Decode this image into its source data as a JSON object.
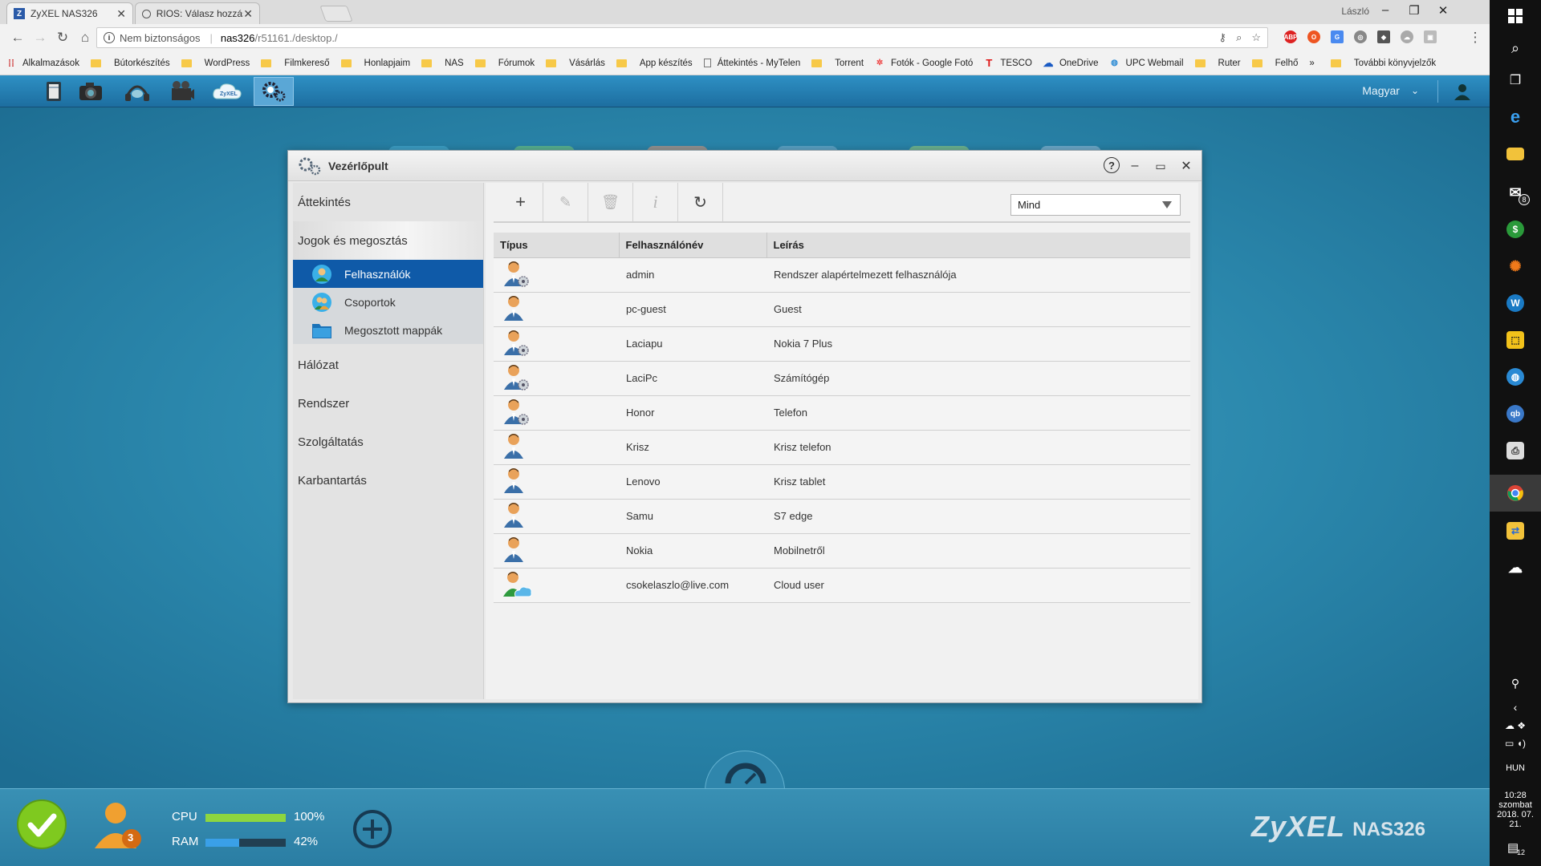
{
  "browser": {
    "tabs": [
      {
        "title": "ZyXEL NAS326",
        "active": true
      },
      {
        "title": "RIOS: Válasz hozzászólás",
        "active": false
      }
    ],
    "profile_name": "László",
    "security_label": "Nem biztonságos",
    "url_host": "nas326",
    "url_path": "/r51161./desktop./",
    "bookmarks": [
      "Alkalmazások",
      "Bútorkészítés",
      "WordPress",
      "Filmkereső",
      "Honlapjaim",
      "NAS",
      "Fórumok",
      "Vásárlás",
      "App készítés",
      "Áttekintés - MyTelen",
      "Torrent",
      "Fotók - Google Fotó",
      "TESCO",
      "OneDrive",
      "UPC Webmail",
      "Ruter",
      "Felhő"
    ],
    "bookmarks_more": "»",
    "other_bookmarks": "További könyvjelzők"
  },
  "nas_topbar": {
    "apps": [
      "file-browser",
      "photo",
      "music",
      "video",
      "zyxel-cloud",
      "control-panel"
    ],
    "active_app": "control-panel",
    "language": "Magyar"
  },
  "control_panel": {
    "title": "Vezérlőpult",
    "nav": {
      "overview": "Áttekintés",
      "rights_sharing": "Jogok és megosztás",
      "users": "Felhasználók",
      "groups": "Csoportok",
      "shared_folders": "Megosztott mappák",
      "network": "Hálózat",
      "system": "Rendszer",
      "services": "Szolgáltatás",
      "maintenance": "Karbantartás"
    },
    "filter_value": "Mind",
    "columns": {
      "type": "Típus",
      "username": "Felhasználónév",
      "description": "Leírás"
    },
    "users": [
      {
        "type": "admin-user",
        "username": "admin",
        "description": "Rendszer alapértelmezett felhasználója"
      },
      {
        "type": "user",
        "username": "pc-guest",
        "description": "Guest"
      },
      {
        "type": "admin-user",
        "username": "Laciapu",
        "description": "Nokia 7 Plus"
      },
      {
        "type": "admin-user",
        "username": "LaciPc",
        "description": "Számítógép"
      },
      {
        "type": "admin-user",
        "username": "Honor",
        "description": "Telefon"
      },
      {
        "type": "user",
        "username": "Krisz",
        "description": "Krisz telefon"
      },
      {
        "type": "user",
        "username": "Lenovo",
        "description": "Krisz tablet"
      },
      {
        "type": "user",
        "username": "Samu",
        "description": "S7 edge"
      },
      {
        "type": "user",
        "username": "Nokia",
        "description": "Mobilnetről"
      },
      {
        "type": "cloud-user",
        "username": "csokelaszlo@live.com",
        "description": "Cloud user"
      }
    ]
  },
  "dock": {
    "notifications_count": "3",
    "cpu_label": "CPU",
    "cpu_value": "100%",
    "cpu_fraction": 1.0,
    "ram_label": "RAM",
    "ram_value": "42%",
    "ram_fraction": 0.42,
    "brand": "ZyXEL",
    "model": "NAS326"
  },
  "taskbar": {
    "language": "HUN",
    "time": "10:28",
    "day": "szombat",
    "date": "2018. 07. 21.",
    "mail_badge": "8",
    "notification_badge": "12"
  },
  "colors": {
    "accent_selected": "#0f5aa8",
    "cpu_bar": "#8dd640",
    "ram_bar": "#3aa0e8",
    "desktop_bg": "#2a86ab"
  }
}
